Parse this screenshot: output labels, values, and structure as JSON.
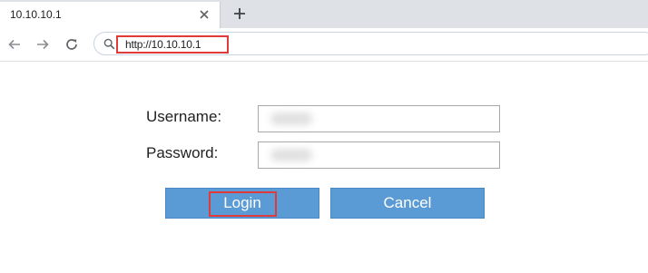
{
  "browser": {
    "tab_title": "10.10.10.1",
    "address_url": "http://10.10.10.1",
    "icons": {
      "tab_close": "close-icon",
      "new_tab": "plus-icon",
      "back": "arrow-left-icon",
      "forward": "arrow-right-icon",
      "reload": "reload-icon",
      "address_search": "search-icon"
    }
  },
  "login_form": {
    "username_label": "Username:",
    "password_label": "Password:",
    "username_value": "",
    "password_value": "",
    "login_label": "Login",
    "cancel_label": "Cancel"
  },
  "colors": {
    "button_fill": "#5b9bd5",
    "highlight_border": "#e03a3a"
  }
}
